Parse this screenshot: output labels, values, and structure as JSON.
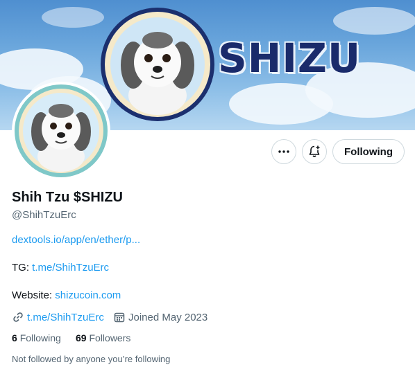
{
  "banner": {
    "brand_text": "SHIZU"
  },
  "actions": {
    "follow_label": "Following"
  },
  "profile": {
    "display_name": "Shih Tzu $SHIZU",
    "handle": "@ShihTzuErc",
    "bio_link": "dextools.io/app/en/ether/p...",
    "tg_label": "TG:",
    "tg_link": "t.me/ShihTzuErc",
    "website_label": "Website:",
    "website_link": "shizucoin.com",
    "profile_url": "t.me/ShihTzuErc",
    "joined": "Joined May 2023",
    "following_count": "6",
    "following_label": "Following",
    "followers_count": "69",
    "followers_label": "Followers",
    "followed_by": "Not followed by anyone you’re following"
  },
  "colors": {
    "link": "#1d9bf0",
    "muted": "#536471",
    "text": "#0f1419",
    "border": "#cfd9de"
  }
}
